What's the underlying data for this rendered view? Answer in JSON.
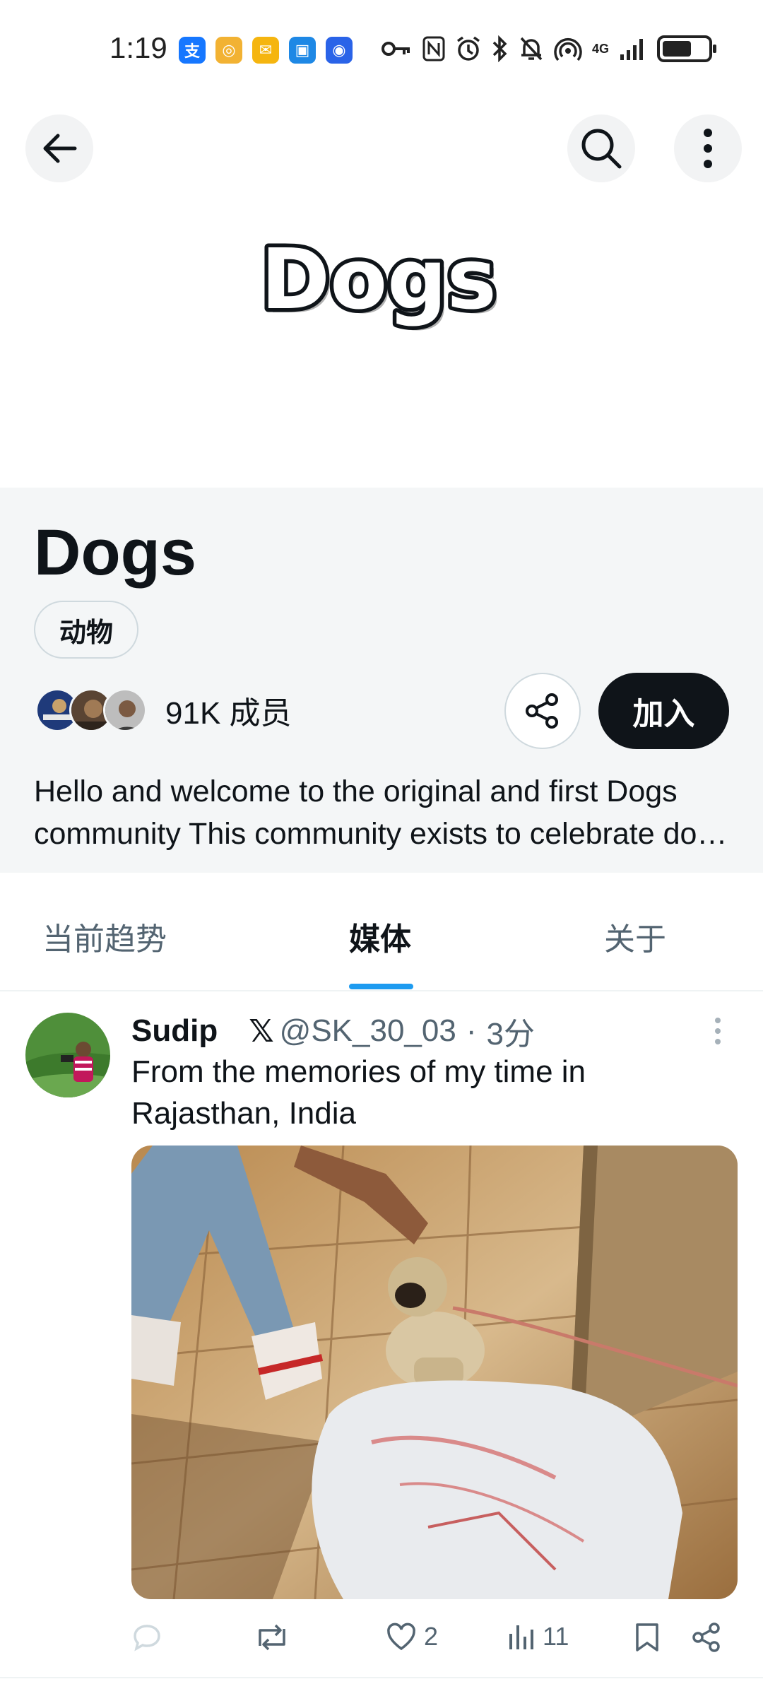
{
  "status_bar": {
    "time": "1:19",
    "network": "4G",
    "apps": [
      {
        "icon": "alipay-icon",
        "glyph": "支",
        "color": "#1677ff"
      },
      {
        "icon": "target-app-icon",
        "glyph": "◎",
        "color": "#f2b233"
      },
      {
        "icon": "mail-app-icon",
        "glyph": "✉",
        "color": "#f5b50f"
      },
      {
        "icon": "shopping-app-icon",
        "glyph": "▣",
        "color": "#1e88e5"
      },
      {
        "icon": "shield-app-icon",
        "glyph": "◉",
        "color": "#2a63e8"
      }
    ],
    "battery_level": 0.65
  },
  "nav": {
    "back_icon": "arrow-left-icon",
    "search_icon": "search-icon",
    "more_icon": "more-vertical-icon"
  },
  "banner": {
    "logo_text": "Dogs"
  },
  "community": {
    "name": "Dogs",
    "category": "动物",
    "members_count": "91K 成员",
    "join_label": "加入",
    "description": "Hello and welcome to the original and first Dogs community This community exists to celebrate dogs and everything about them"
  },
  "tabs": [
    {
      "label": "当前趋势",
      "active": false
    },
    {
      "label": "媒体",
      "active": true
    },
    {
      "label": "关于",
      "active": false
    }
  ],
  "post": {
    "author": "Sudip",
    "x_mark": "𝕏",
    "handle": "@SK_30_03",
    "separator": "·",
    "time": "3分",
    "text": "From the memories of my time in Rajasthan, India",
    "actions": {
      "reply_count": "",
      "repost_count": "",
      "like_count": "2",
      "views_count": "11"
    }
  },
  "colors": {
    "accent": "#1d9bf0",
    "text_primary": "#0f1419",
    "text_secondary": "#536471",
    "panel_bg": "#f4f6f7"
  }
}
